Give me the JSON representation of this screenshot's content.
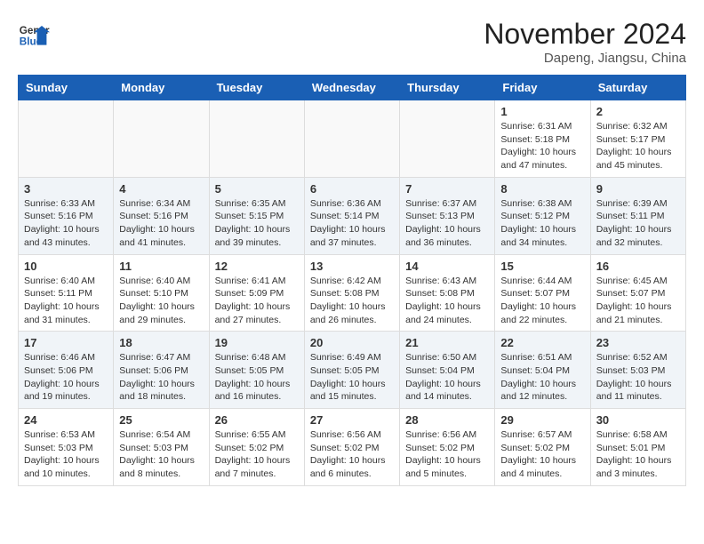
{
  "header": {
    "logo_line1": "General",
    "logo_line2": "Blue",
    "month": "November 2024",
    "location": "Dapeng, Jiangsu, China"
  },
  "weekdays": [
    "Sunday",
    "Monday",
    "Tuesday",
    "Wednesday",
    "Thursday",
    "Friday",
    "Saturday"
  ],
  "weeks": [
    [
      {
        "day": "",
        "info": ""
      },
      {
        "day": "",
        "info": ""
      },
      {
        "day": "",
        "info": ""
      },
      {
        "day": "",
        "info": ""
      },
      {
        "day": "",
        "info": ""
      },
      {
        "day": "1",
        "info": "Sunrise: 6:31 AM\nSunset: 5:18 PM\nDaylight: 10 hours\nand 47 minutes."
      },
      {
        "day": "2",
        "info": "Sunrise: 6:32 AM\nSunset: 5:17 PM\nDaylight: 10 hours\nand 45 minutes."
      }
    ],
    [
      {
        "day": "3",
        "info": "Sunrise: 6:33 AM\nSunset: 5:16 PM\nDaylight: 10 hours\nand 43 minutes."
      },
      {
        "day": "4",
        "info": "Sunrise: 6:34 AM\nSunset: 5:16 PM\nDaylight: 10 hours\nand 41 minutes."
      },
      {
        "day": "5",
        "info": "Sunrise: 6:35 AM\nSunset: 5:15 PM\nDaylight: 10 hours\nand 39 minutes."
      },
      {
        "day": "6",
        "info": "Sunrise: 6:36 AM\nSunset: 5:14 PM\nDaylight: 10 hours\nand 37 minutes."
      },
      {
        "day": "7",
        "info": "Sunrise: 6:37 AM\nSunset: 5:13 PM\nDaylight: 10 hours\nand 36 minutes."
      },
      {
        "day": "8",
        "info": "Sunrise: 6:38 AM\nSunset: 5:12 PM\nDaylight: 10 hours\nand 34 minutes."
      },
      {
        "day": "9",
        "info": "Sunrise: 6:39 AM\nSunset: 5:11 PM\nDaylight: 10 hours\nand 32 minutes."
      }
    ],
    [
      {
        "day": "10",
        "info": "Sunrise: 6:40 AM\nSunset: 5:11 PM\nDaylight: 10 hours\nand 31 minutes."
      },
      {
        "day": "11",
        "info": "Sunrise: 6:40 AM\nSunset: 5:10 PM\nDaylight: 10 hours\nand 29 minutes."
      },
      {
        "day": "12",
        "info": "Sunrise: 6:41 AM\nSunset: 5:09 PM\nDaylight: 10 hours\nand 27 minutes."
      },
      {
        "day": "13",
        "info": "Sunrise: 6:42 AM\nSunset: 5:08 PM\nDaylight: 10 hours\nand 26 minutes."
      },
      {
        "day": "14",
        "info": "Sunrise: 6:43 AM\nSunset: 5:08 PM\nDaylight: 10 hours\nand 24 minutes."
      },
      {
        "day": "15",
        "info": "Sunrise: 6:44 AM\nSunset: 5:07 PM\nDaylight: 10 hours\nand 22 minutes."
      },
      {
        "day": "16",
        "info": "Sunrise: 6:45 AM\nSunset: 5:07 PM\nDaylight: 10 hours\nand 21 minutes."
      }
    ],
    [
      {
        "day": "17",
        "info": "Sunrise: 6:46 AM\nSunset: 5:06 PM\nDaylight: 10 hours\nand 19 minutes."
      },
      {
        "day": "18",
        "info": "Sunrise: 6:47 AM\nSunset: 5:06 PM\nDaylight: 10 hours\nand 18 minutes."
      },
      {
        "day": "19",
        "info": "Sunrise: 6:48 AM\nSunset: 5:05 PM\nDaylight: 10 hours\nand 16 minutes."
      },
      {
        "day": "20",
        "info": "Sunrise: 6:49 AM\nSunset: 5:05 PM\nDaylight: 10 hours\nand 15 minutes."
      },
      {
        "day": "21",
        "info": "Sunrise: 6:50 AM\nSunset: 5:04 PM\nDaylight: 10 hours\nand 14 minutes."
      },
      {
        "day": "22",
        "info": "Sunrise: 6:51 AM\nSunset: 5:04 PM\nDaylight: 10 hours\nand 12 minutes."
      },
      {
        "day": "23",
        "info": "Sunrise: 6:52 AM\nSunset: 5:03 PM\nDaylight: 10 hours\nand 11 minutes."
      }
    ],
    [
      {
        "day": "24",
        "info": "Sunrise: 6:53 AM\nSunset: 5:03 PM\nDaylight: 10 hours\nand 10 minutes."
      },
      {
        "day": "25",
        "info": "Sunrise: 6:54 AM\nSunset: 5:03 PM\nDaylight: 10 hours\nand 8 minutes."
      },
      {
        "day": "26",
        "info": "Sunrise: 6:55 AM\nSunset: 5:02 PM\nDaylight: 10 hours\nand 7 minutes."
      },
      {
        "day": "27",
        "info": "Sunrise: 6:56 AM\nSunset: 5:02 PM\nDaylight: 10 hours\nand 6 minutes."
      },
      {
        "day": "28",
        "info": "Sunrise: 6:56 AM\nSunset: 5:02 PM\nDaylight: 10 hours\nand 5 minutes."
      },
      {
        "day": "29",
        "info": "Sunrise: 6:57 AM\nSunset: 5:02 PM\nDaylight: 10 hours\nand 4 minutes."
      },
      {
        "day": "30",
        "info": "Sunrise: 6:58 AM\nSunset: 5:01 PM\nDaylight: 10 hours\nand 3 minutes."
      }
    ]
  ]
}
